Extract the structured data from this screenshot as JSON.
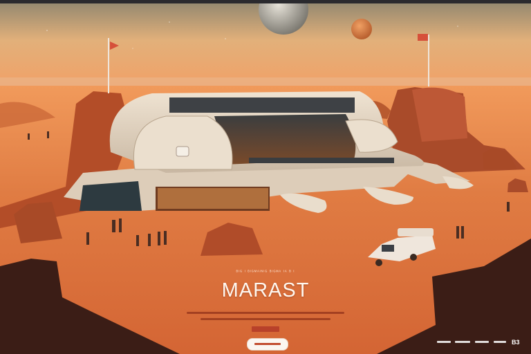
{
  "hero": {
    "title": "MARAST",
    "eyebrow": "ᴮᴵᴳ  ᴵ  ᴮᴵᴳᴹᴬᴵᴺᴵᴳ  ᴮᴵᴳᴹᴬ  ᴵᴬ  ᴮ ᴵ",
    "cta_label": ""
  },
  "footer": {
    "mark": "B3"
  },
  "colors": {
    "sky_top": "#9b8a6a",
    "sky_horizon": "#f0a766",
    "ground": "#d9703a",
    "accent": "#b8412a"
  }
}
